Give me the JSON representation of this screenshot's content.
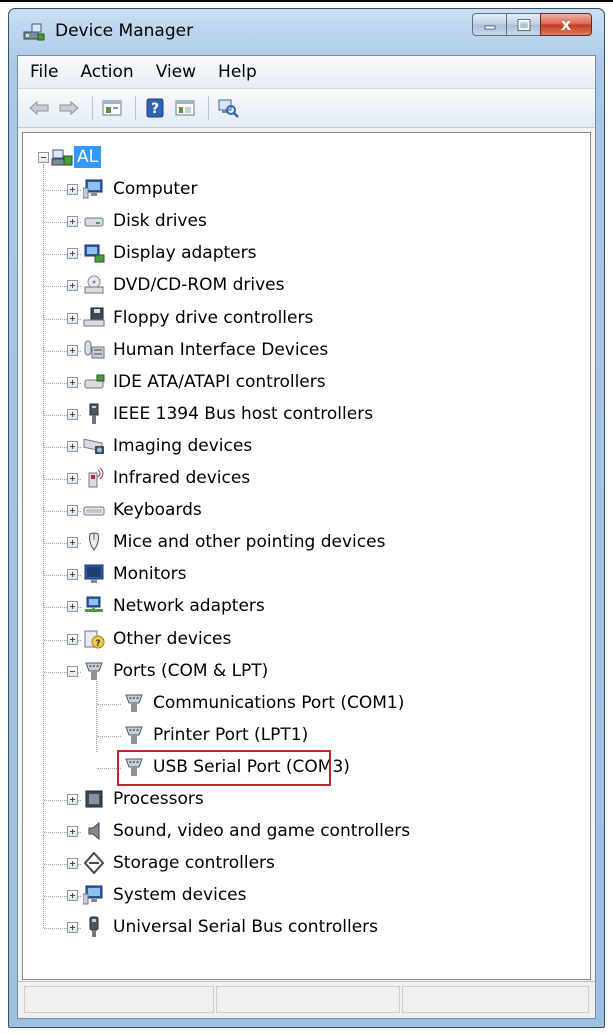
{
  "window": {
    "title": "Device Manager",
    "caption_buttons": {
      "minimize": "–",
      "maximize": "□",
      "close": "x"
    }
  },
  "menu": [
    "File",
    "Action",
    "View",
    "Help"
  ],
  "toolbar": {
    "buttons": [
      "back-icon",
      "forward-icon",
      "properties-icon",
      "help-icon",
      "view-icon",
      "scan-hardware-icon"
    ],
    "help_glyph": "?"
  },
  "tree": {
    "root": "AL",
    "categories": [
      {
        "label": "Computer",
        "icon": "computer-icon",
        "expanded": false
      },
      {
        "label": "Disk drives",
        "icon": "disk-drive-icon",
        "expanded": false
      },
      {
        "label": "Display adapters",
        "icon": "display-adapter-icon",
        "expanded": false
      },
      {
        "label": "DVD/CD-ROM drives",
        "icon": "dvd-drive-icon",
        "expanded": false
      },
      {
        "label": "Floppy drive controllers",
        "icon": "floppy-controller-icon",
        "expanded": false
      },
      {
        "label": "Human Interface Devices",
        "icon": "hid-icon",
        "expanded": false
      },
      {
        "label": "IDE ATA/ATAPI controllers",
        "icon": "ide-controller-icon",
        "expanded": false
      },
      {
        "label": "IEEE 1394 Bus host controllers",
        "icon": "ieee1394-icon",
        "expanded": false
      },
      {
        "label": "Imaging devices",
        "icon": "imaging-device-icon",
        "expanded": false
      },
      {
        "label": "Infrared devices",
        "icon": "infrared-icon",
        "expanded": false
      },
      {
        "label": "Keyboards",
        "icon": "keyboard-icon",
        "expanded": false
      },
      {
        "label": "Mice and other pointing devices",
        "icon": "mouse-icon",
        "expanded": false
      },
      {
        "label": "Monitors",
        "icon": "monitor-icon",
        "expanded": false
      },
      {
        "label": "Network adapters",
        "icon": "network-adapter-icon",
        "expanded": false
      },
      {
        "label": "Other devices",
        "icon": "other-device-icon",
        "expanded": false
      },
      {
        "label": "Ports (COM & LPT)",
        "icon": "port-icon",
        "expanded": true,
        "children": [
          "Communications Port (COM1)",
          "Printer Port (LPT1)",
          "USB Serial Port (COM3)"
        ]
      },
      {
        "label": "Processors",
        "icon": "processor-icon",
        "expanded": false
      },
      {
        "label": "Sound, video and game controllers",
        "icon": "sound-icon",
        "expanded": false
      },
      {
        "label": "Storage controllers",
        "icon": "storage-controller-icon",
        "expanded": false
      },
      {
        "label": "System devices",
        "icon": "system-device-icon",
        "expanded": false
      },
      {
        "label": "Universal Serial Bus controllers",
        "icon": "usb-controller-icon",
        "expanded": false
      }
    ],
    "highlighted": "USB Serial Port (COM3)",
    "highlight_color": "#c0282d",
    "selection_color": "#3399ff"
  }
}
